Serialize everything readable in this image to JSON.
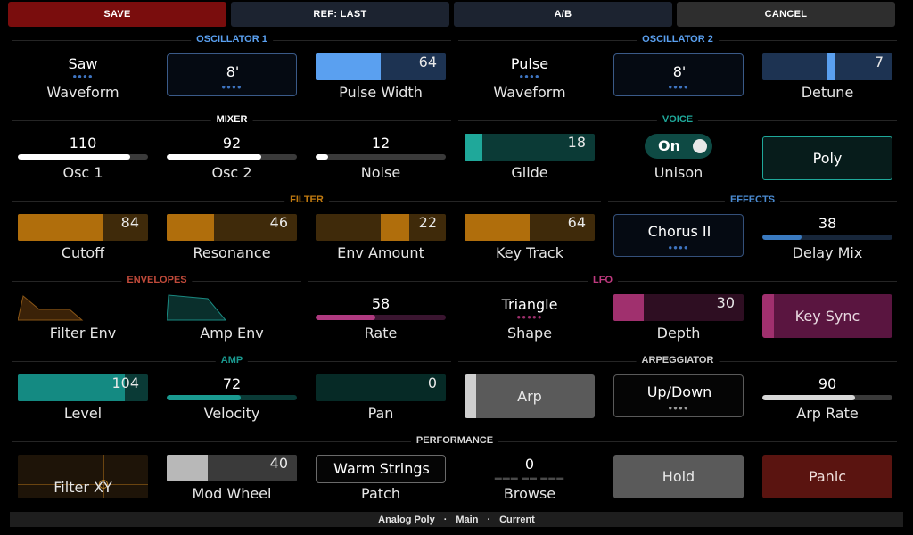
{
  "topbar": {
    "save": "SAVE",
    "ref": "REF: LAST",
    "ab": "A/B",
    "cancel": "CANCEL"
  },
  "sections": {
    "osc1": "OSCILLATOR 1",
    "osc2": "OSCILLATOR 2",
    "mixer": "MIXER",
    "voice": "VOICE",
    "filter": "FILTER",
    "effects": "EFFECTS",
    "envelopes": "ENVELOPES",
    "lfo": "LFO",
    "amp": "AMP",
    "arpeggiator": "ARPEGGIATOR",
    "performance": "PERFORMANCE"
  },
  "osc1": {
    "waveform_value": "Saw",
    "waveform_label": "Waveform",
    "octave_value": "8'",
    "pw_value": "64",
    "pw_label": "Pulse Width"
  },
  "osc2": {
    "waveform_value": "Pulse",
    "waveform_label": "Waveform",
    "octave_value": "8'",
    "detune_value": "7",
    "detune_label": "Detune"
  },
  "mixer": {
    "osc1_value": "110",
    "osc1_label": "Osc 1",
    "osc2_value": "92",
    "osc2_label": "Osc 2",
    "noise_value": "12",
    "noise_label": "Noise"
  },
  "voice": {
    "glide_value": "18",
    "glide_label": "Glide",
    "unison_state": "On",
    "unison_label": "Unison",
    "poly_label": "Poly"
  },
  "filter": {
    "cutoff_value": "84",
    "cutoff_label": "Cutoff",
    "res_value": "46",
    "res_label": "Resonance",
    "env_value": "22",
    "env_label": "Env Amount",
    "keytrack_value": "64",
    "keytrack_label": "Key Track"
  },
  "effects": {
    "type_value": "Chorus II",
    "delay_value": "38",
    "delay_label": "Delay Mix"
  },
  "envelopes": {
    "filter_label": "Filter Env",
    "amp_label": "Amp Env"
  },
  "lfo": {
    "rate_value": "58",
    "rate_label": "Rate",
    "shape_value": "Triangle",
    "shape_label": "Shape",
    "depth_value": "30",
    "depth_label": "Depth",
    "keysync_label": "Key Sync"
  },
  "amp": {
    "level_value": "104",
    "level_label": "Level",
    "velocity_value": "72",
    "velocity_label": "Velocity",
    "pan_value": "0",
    "pan_label": "Pan"
  },
  "arp": {
    "arp_label": "Arp",
    "mode_value": "Up/Down",
    "rate_value": "90",
    "rate_label": "Arp Rate"
  },
  "performance": {
    "xy_label": "Filter XY",
    "modwheel_value": "40",
    "modwheel_label": "Mod Wheel",
    "patch_value": "Warm Strings",
    "patch_label": "Patch",
    "browse_value": "0",
    "browse_label": "Browse",
    "hold_label": "Hold",
    "panic_label": "Panic"
  },
  "statusbar": {
    "patch": "Analog Poly",
    "sep1": "·",
    "bank": "Main",
    "sep2": "·",
    "state": "Current"
  },
  "colors": {
    "save": "#7a0d0d",
    "osc": "#5aa0f0",
    "mixer": "#ffffff",
    "voice": "#1fa89a",
    "filter": "#c07a10",
    "effects": "#4a8ad0",
    "envelopes": "#c04a3a",
    "lfo": "#c03a80",
    "amp": "#1a9a90",
    "arp": "#cfcfcf"
  }
}
